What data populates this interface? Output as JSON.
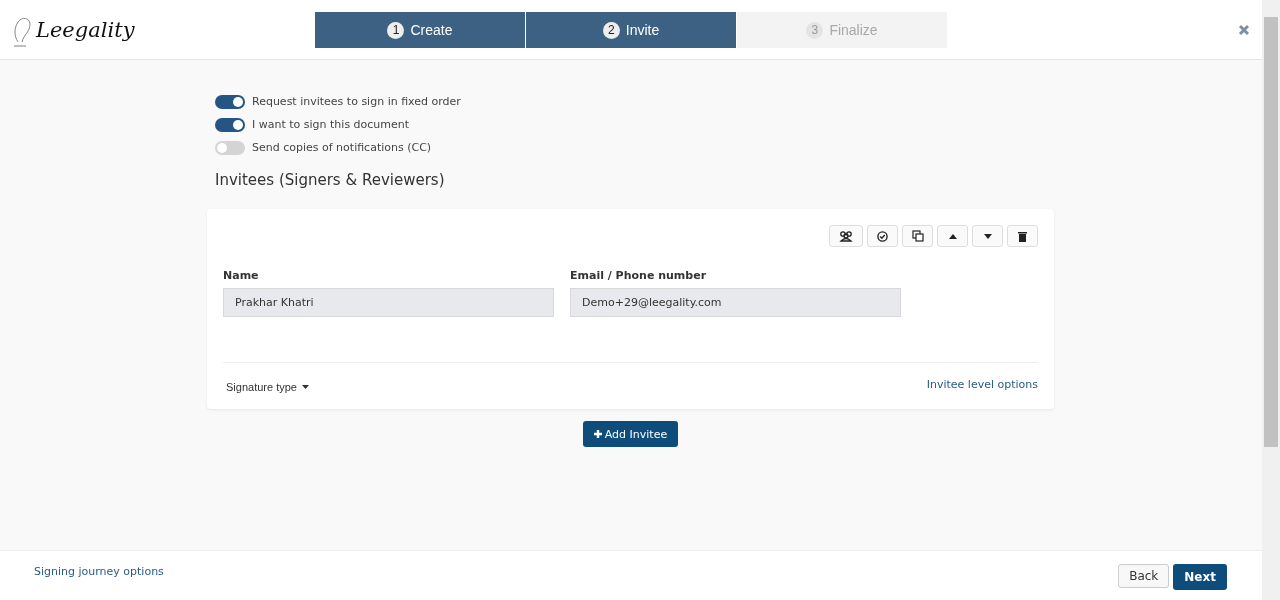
{
  "logo": "Leegality",
  "steps": [
    {
      "number": "1",
      "label": "Create",
      "disabled": false
    },
    {
      "number": "2",
      "label": "Invite",
      "disabled": false
    },
    {
      "number": "3",
      "label": "Finalize",
      "disabled": true
    }
  ],
  "toggles": [
    {
      "label": "Request invitees to sign in fixed order",
      "on": true
    },
    {
      "label": "I want to sign this document",
      "on": true
    },
    {
      "label": "Send copies of notifications (CC)",
      "on": false
    }
  ],
  "section_title": "Invitees (Signers & Reviewers)",
  "invitee": {
    "fields": [
      {
        "label": "Name",
        "value": "Prakhar Khatri"
      },
      {
        "label": "Email / Phone number",
        "value": "Demo+29@leegality.com"
      }
    ],
    "signature_type": "Signature type",
    "options_link": "Invitee level options"
  },
  "add_button": "Add Invitee",
  "footer": {
    "link": "Signing journey options",
    "back": "Back",
    "next": "Next"
  }
}
